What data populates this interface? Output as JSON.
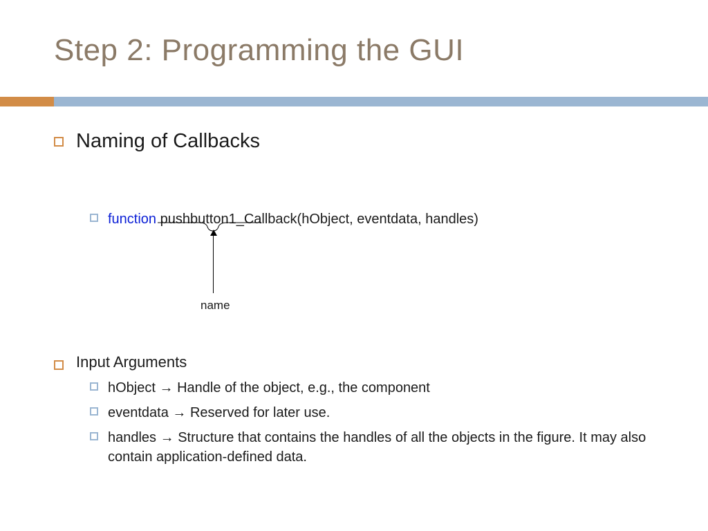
{
  "slide": {
    "title": "Step 2: Programming the GUI",
    "section1": "Naming of Callbacks",
    "code_keyword": "function",
    "code_rest": " pushbutton1_Callback(hObject, eventdata, handles)",
    "annotation_label": "name",
    "section2": "Input Arguments",
    "args": [
      {
        "name": "hObject",
        "arrow": " → ",
        "desc": "Handle of the object, e.g., the component"
      },
      {
        "name": "eventdata",
        "arrow": " → ",
        "desc": "Reserved for later use."
      },
      {
        "name": "handles",
        "arrow": " → ",
        "desc": "Structure that contains the handles of all the objects in the figure. It may also contain application-defined data."
      }
    ]
  }
}
